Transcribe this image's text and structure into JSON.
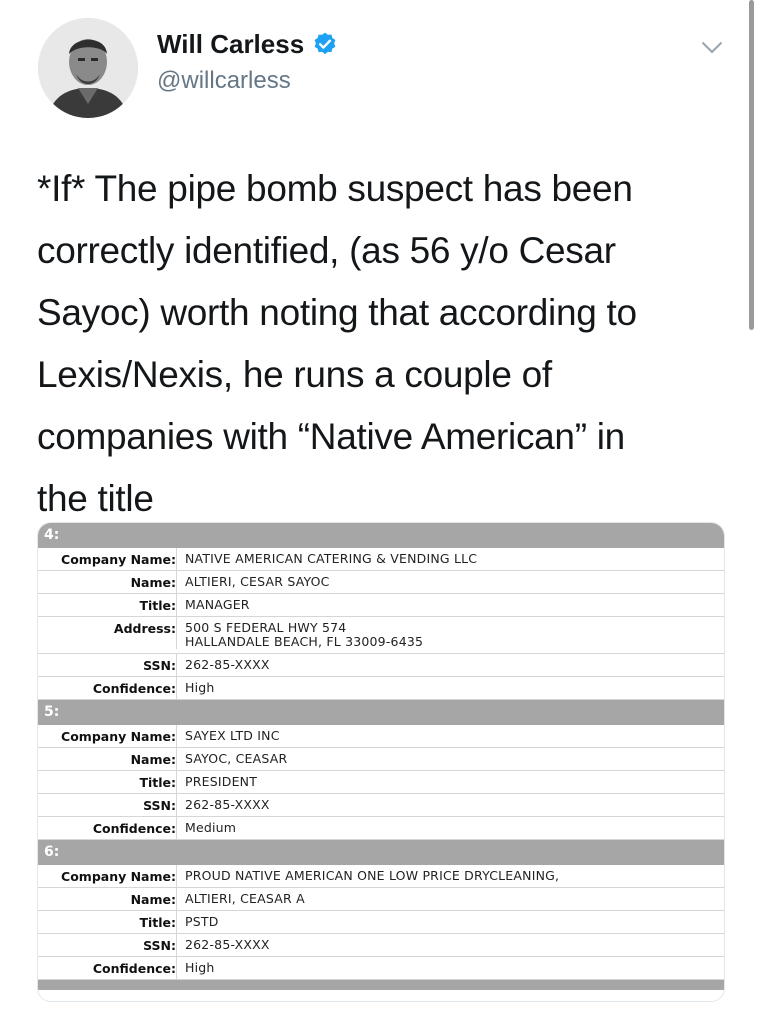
{
  "user": {
    "display_name": "Will Carless",
    "handle": "@willcarless",
    "verified": true
  },
  "tweet": {
    "lines": [
      "*If* The pipe bomb suspect has been",
      "correctly identified, (as 56 y/o Cesar",
      "Sayoc) worth noting that according to",
      "Lexis/Nexis, he runs a couple of",
      "companies with “Native American” in",
      "the title"
    ]
  },
  "records": [
    {
      "number": "4:",
      "fields": [
        {
          "label": "Company Name:",
          "value": "NATIVE AMERICAN CATERING & VENDING LLC"
        },
        {
          "label": "Name:",
          "value": "ALTIERI, CESAR SAYOC"
        },
        {
          "label": "Title:",
          "value": "MANAGER"
        },
        {
          "label": "Address:",
          "value": "500 S FEDERAL HWY 574",
          "value2": "HALLANDALE BEACH, FL 33009-6435"
        },
        {
          "label": "SSN:",
          "value": "262-85-XXXX"
        },
        {
          "label": "Confidence:",
          "value": "High"
        }
      ]
    },
    {
      "number": "5:",
      "fields": [
        {
          "label": "Company Name:",
          "value": "SAYEX LTD INC"
        },
        {
          "label": "Name:",
          "value": "SAYOC, CEASAR"
        },
        {
          "label": "Title:",
          "value": "PRESIDENT"
        },
        {
          "label": "SSN:",
          "value": "262-85-XXXX"
        },
        {
          "label": "Confidence:",
          "value": "Medium"
        }
      ]
    },
    {
      "number": "6:",
      "fields": [
        {
          "label": "Company Name:",
          "value": "PROUD NATIVE AMERICAN ONE LOW PRICE DRYCLEANING,"
        },
        {
          "label": "Name:",
          "value": "ALTIERI, CEASAR A"
        },
        {
          "label": "Title:",
          "value": "PSTD"
        },
        {
          "label": "SSN:",
          "value": "262-85-XXXX"
        },
        {
          "label": "Confidence:",
          "value": "High"
        }
      ]
    }
  ],
  "colors": {
    "verified_badge": "#1da1f2",
    "handle": "#657786",
    "record_header": "#a6a6a6"
  },
  "icons": {
    "verified": "verified-badge-icon",
    "menu": "chevron-down-icon"
  }
}
